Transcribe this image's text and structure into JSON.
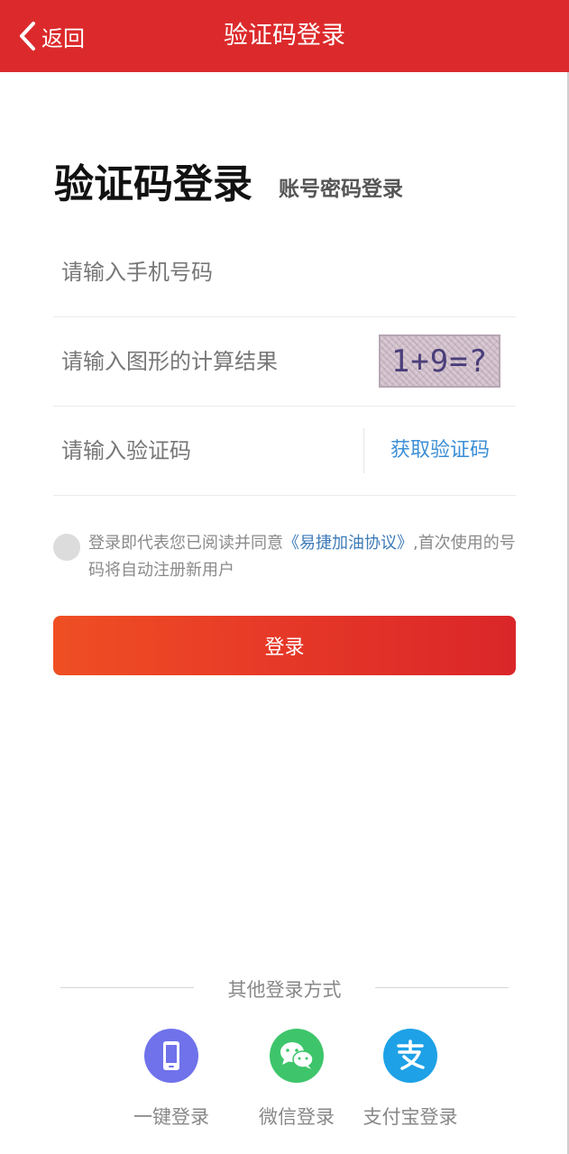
{
  "header": {
    "back_label": "返回",
    "title": "验证码登录",
    "color": "#dc2a2c"
  },
  "tabs": {
    "active": "验证码登录",
    "alt": "账号密码登录"
  },
  "form": {
    "phone_placeholder": "请输入手机号码",
    "captcha_placeholder": "请输入图形的计算结果",
    "captcha_text": "1+9=?",
    "code_placeholder": "请输入验证码",
    "get_code_label": "获取验证码"
  },
  "agreement": {
    "prefix": "登录即代表您已阅读并同意",
    "link": "《易捷加油协议》",
    "suffix": ",首次使用的号码将自动注册新用户",
    "checked": false
  },
  "login_button": "登录",
  "other_login": {
    "title": "其他登录方式",
    "methods": [
      {
        "label": "一键登录",
        "icon": "phone-icon",
        "color": "#6f72ea"
      },
      {
        "label": "微信登录",
        "icon": "wechat-icon",
        "color": "#3ec56b"
      },
      {
        "label": "支付宝登录",
        "icon": "alipay-icon",
        "color": "#1ea1e6"
      }
    ]
  }
}
